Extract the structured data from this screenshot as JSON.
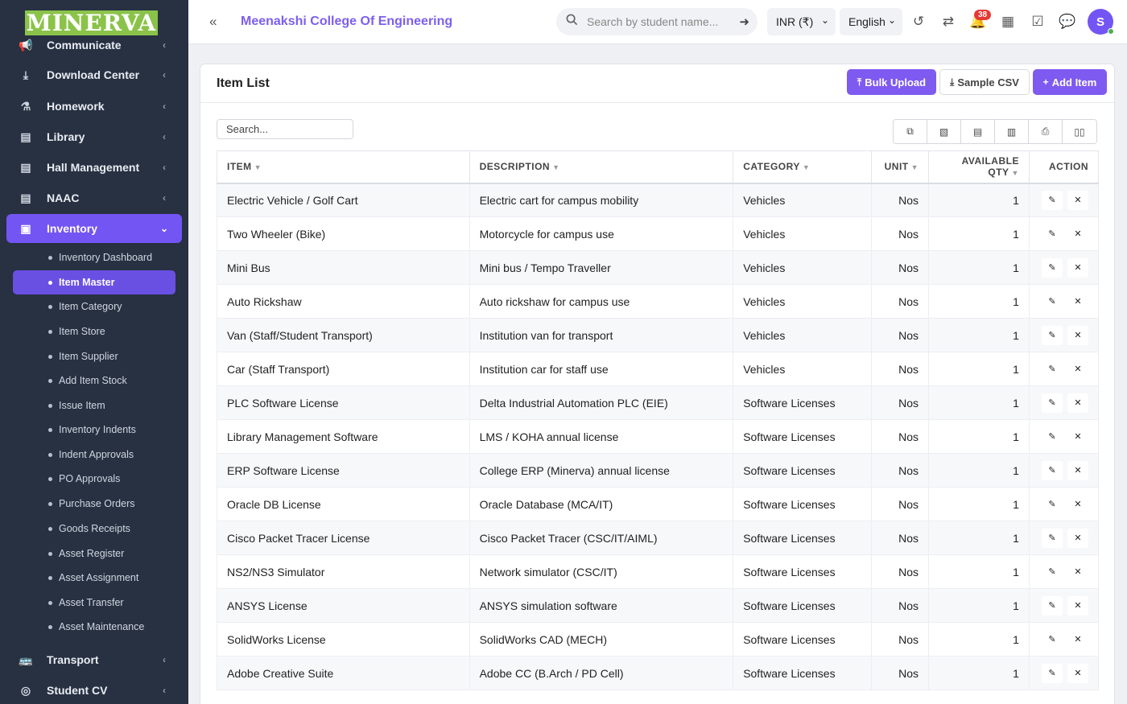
{
  "sidebar": {
    "logo": "MINERVA",
    "items": [
      {
        "label": "Communicate",
        "icon": "megaphone-icon"
      },
      {
        "label": "Download Center",
        "icon": "download-icon"
      },
      {
        "label": "Homework",
        "icon": "flask-icon"
      },
      {
        "label": "Library",
        "icon": "book-icon"
      },
      {
        "label": "Hall Management",
        "icon": "book-icon"
      },
      {
        "label": "NAAC",
        "icon": "book-icon"
      },
      {
        "label": "Inventory",
        "icon": "inventory-icon"
      },
      {
        "label": "Transport",
        "icon": "bus-icon"
      },
      {
        "label": "Student CV",
        "icon": "cv-icon"
      }
    ],
    "inventory_sub": [
      "Inventory Dashboard",
      "Item Master",
      "Item Category",
      "Item Store",
      "Item Supplier",
      "Add Item Stock",
      "Issue Item",
      "Inventory Indents",
      "Indent Approvals",
      "PO Approvals",
      "Purchase Orders",
      "Goods Receipts",
      "Asset Register",
      "Asset Assignment",
      "Asset Transfer",
      "Asset Maintenance"
    ]
  },
  "header": {
    "college": "Meenakshi College Of Engineering",
    "search_placeholder": "Search by student name...",
    "currency": "INR (₹)",
    "language": "English",
    "notif_count": "38",
    "avatar_initial": "S"
  },
  "card": {
    "title": "Item List",
    "bulk_upload": "Bulk Upload",
    "sample_csv": "Sample CSV",
    "add_item": "Add Item",
    "search_placeholder": "Search..."
  },
  "table": {
    "columns": [
      "ITEM",
      "DESCRIPTION",
      "CATEGORY",
      "UNIT",
      "AVAILABLE QTY",
      "ACTION"
    ],
    "rows": [
      [
        "Electric Vehicle / Golf Cart",
        "Electric cart for campus mobility",
        "Vehicles",
        "Nos",
        "1"
      ],
      [
        "Two Wheeler (Bike)",
        "Motorcycle for campus use",
        "Vehicles",
        "Nos",
        "1"
      ],
      [
        "Mini Bus",
        "Mini bus / Tempo Traveller",
        "Vehicles",
        "Nos",
        "1"
      ],
      [
        "Auto Rickshaw",
        "Auto rickshaw for campus use",
        "Vehicles",
        "Nos",
        "1"
      ],
      [
        "Van (Staff/Student Transport)",
        "Institution van for transport",
        "Vehicles",
        "Nos",
        "1"
      ],
      [
        "Car (Staff Transport)",
        "Institution car for staff use",
        "Vehicles",
        "Nos",
        "1"
      ],
      [
        "PLC Software License",
        "Delta Industrial Automation PLC (EIE)",
        "Software Licenses",
        "Nos",
        "1"
      ],
      [
        "Library Management Software",
        "LMS / KOHA annual license",
        "Software Licenses",
        "Nos",
        "1"
      ],
      [
        "ERP Software License",
        "College ERP (Minerva) annual license",
        "Software Licenses",
        "Nos",
        "1"
      ],
      [
        "Oracle DB License",
        "Oracle Database (MCA/IT)",
        "Software Licenses",
        "Nos",
        "1"
      ],
      [
        "Cisco Packet Tracer License",
        "Cisco Packet Tracer (CSC/IT/AIML)",
        "Software Licenses",
        "Nos",
        "1"
      ],
      [
        "NS2/NS3 Simulator",
        "Network simulator (CSC/IT)",
        "Software Licenses",
        "Nos",
        "1"
      ],
      [
        "ANSYS License",
        "ANSYS simulation software",
        "Software Licenses",
        "Nos",
        "1"
      ],
      [
        "SolidWorks License",
        "SolidWorks CAD (MECH)",
        "Software Licenses",
        "Nos",
        "1"
      ],
      [
        "Adobe Creative Suite",
        "Adobe CC (B.Arch / PD Cell)",
        "Software Licenses",
        "Nos",
        "1"
      ]
    ]
  },
  "colors": {
    "sidebar_bg": "#273142",
    "accent": "#7355f4",
    "logo_bg": "#8bc34a"
  }
}
